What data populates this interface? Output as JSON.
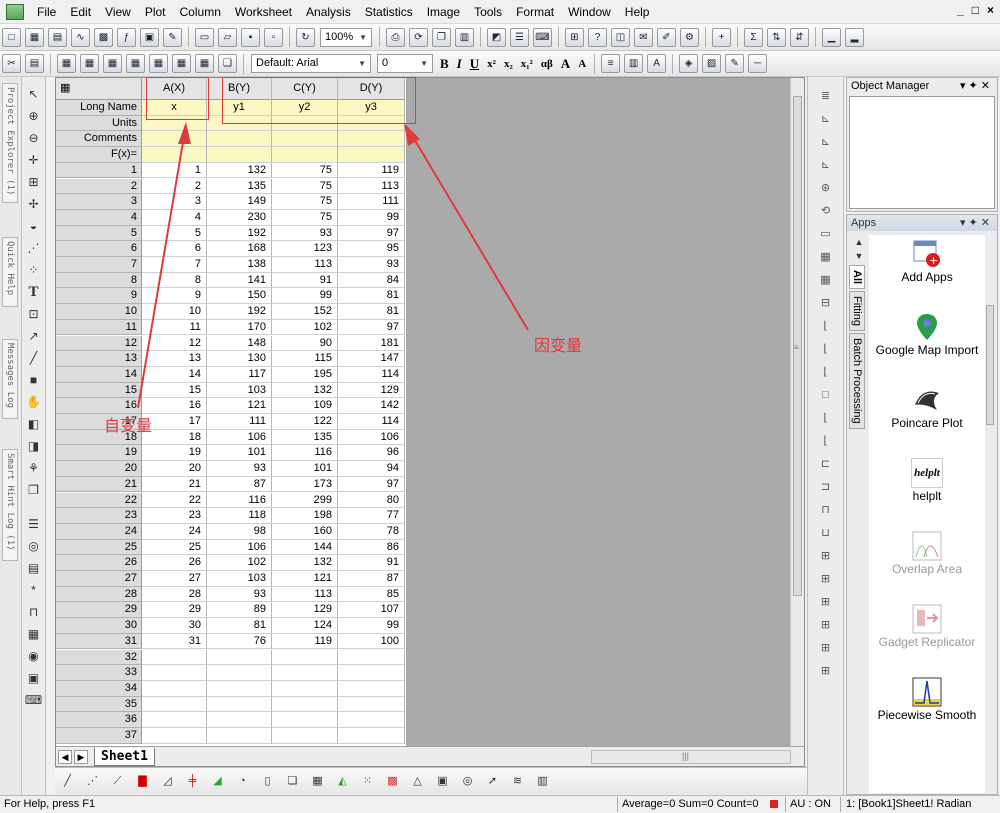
{
  "menu": [
    "File",
    "Edit",
    "View",
    "Plot",
    "Column",
    "Worksheet",
    "Analysis",
    "Statistics",
    "Image",
    "Tools",
    "Format",
    "Window",
    "Help"
  ],
  "window_controls": [
    "_",
    "□",
    "×"
  ],
  "toolbar": {
    "zoom": "100%",
    "font": "Default: Arial",
    "font_size": "0",
    "format_buttons": [
      "B",
      "I",
      "U",
      "x²",
      "x₂",
      "x₁²",
      "αβ",
      "A",
      "A"
    ],
    "sigma": "Σ"
  },
  "left_tabs": [
    "Project Explorer (1)",
    "Quick Help",
    "Messages Log",
    "Smart Hint Log (1)"
  ],
  "left_tools": [
    "pointer",
    "zoom-in",
    "zoom-out",
    "crosshair",
    "scale",
    "data-reader",
    "mask",
    "draw-data",
    "region",
    "T",
    "grid",
    "arrow",
    "line",
    "rectangle",
    "hand",
    "layout",
    "graph",
    "plugin",
    "copy"
  ],
  "sheet": {
    "corner_icon": "grid-icon",
    "columns": [
      "A(X)",
      "B(Y)",
      "C(Y)",
      "D(Y)"
    ],
    "meta_rows": [
      {
        "label": "Long Name",
        "values": [
          "x",
          "y1",
          "y2",
          "y3"
        ]
      },
      {
        "label": "Units",
        "values": [
          "",
          "",
          "",
          ""
        ]
      },
      {
        "label": "Comments",
        "values": [
          "",
          "",
          "",
          ""
        ]
      },
      {
        "label": "F(x)=",
        "values": [
          "",
          "",
          "",
          ""
        ]
      }
    ],
    "rows": [
      [
        1,
        132,
        75,
        119
      ],
      [
        2,
        135,
        75,
        113
      ],
      [
        3,
        149,
        75,
        111
      ],
      [
        4,
        230,
        75,
        99
      ],
      [
        5,
        192,
        93,
        97
      ],
      [
        6,
        168,
        123,
        95
      ],
      [
        7,
        138,
        113,
        93
      ],
      [
        8,
        141,
        91,
        84
      ],
      [
        9,
        150,
        99,
        81
      ],
      [
        10,
        192,
        152,
        81
      ],
      [
        11,
        170,
        102,
        97
      ],
      [
        12,
        148,
        90,
        181
      ],
      [
        13,
        130,
        115,
        147
      ],
      [
        14,
        117,
        195,
        114
      ],
      [
        15,
        103,
        132,
        129
      ],
      [
        16,
        121,
        109,
        142
      ],
      [
        17,
        111,
        122,
        114
      ],
      [
        18,
        106,
        135,
        106
      ],
      [
        19,
        101,
        116,
        96
      ],
      [
        20,
        93,
        101,
        94
      ],
      [
        21,
        87,
        173,
        97
      ],
      [
        22,
        116,
        299,
        80
      ],
      [
        23,
        118,
        198,
        77
      ],
      [
        24,
        98,
        160,
        78
      ],
      [
        25,
        106,
        144,
        86
      ],
      [
        26,
        102,
        132,
        91
      ],
      [
        27,
        103,
        121,
        87
      ],
      [
        28,
        93,
        113,
        85
      ],
      [
        29,
        89,
        129,
        107
      ],
      [
        30,
        81,
        124,
        99
      ],
      [
        31,
        76,
        119,
        100
      ]
    ],
    "empty_rows": [
      32,
      33,
      34,
      35,
      36,
      37
    ],
    "sheet_tab": "Sheet1"
  },
  "annotations": {
    "independent": "自变量",
    "dependent": "因变量",
    "color": "#e0393e"
  },
  "object_manager": {
    "title": "Object Manager"
  },
  "apps": {
    "title": "Apps",
    "tabs": [
      "All",
      "Fitting",
      "Batch Processing"
    ],
    "items": [
      {
        "label": "Add Apps",
        "enabled": true
      },
      {
        "label": "Google Map Import",
        "enabled": true
      },
      {
        "label": "Poincare Plot",
        "enabled": true
      },
      {
        "label": "helplt",
        "enabled": true
      },
      {
        "label": "Overlap Area",
        "enabled": false
      },
      {
        "label": "Gadget Replicator",
        "enabled": false
      },
      {
        "label": "Piecewise Smooth",
        "enabled": true
      }
    ]
  },
  "status": {
    "help": "For Help, press F1",
    "stats": "Average=0 Sum=0 Count=0",
    "au": "AU : ON",
    "sheet": "1: [Book1]Sheet1!  Radian"
  }
}
